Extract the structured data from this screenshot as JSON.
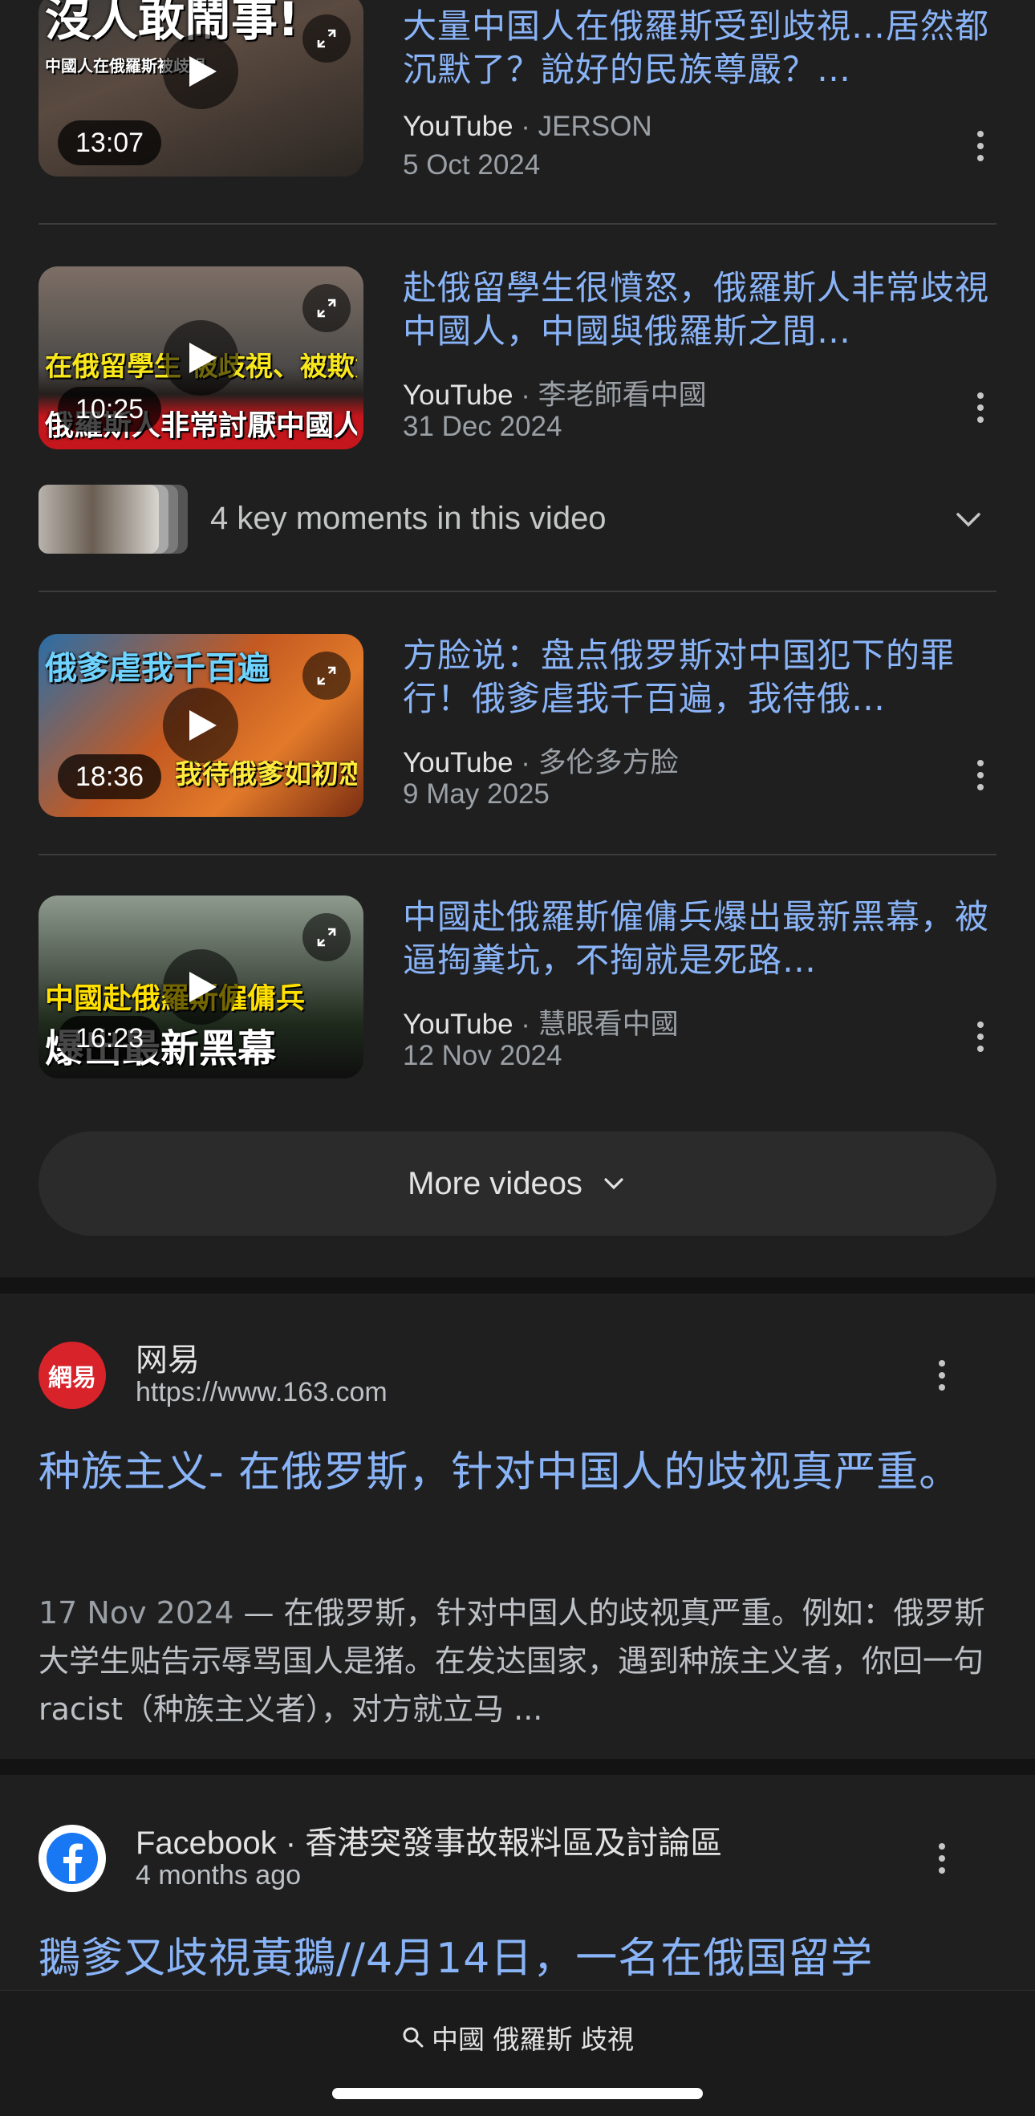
{
  "videos": [
    {
      "title": "大量中国人在俄羅斯受到歧視…居然都沉默了？說好的民族尊嚴？…",
      "platform": "YouTube",
      "channel": "JERSON",
      "date": "5 Oct 2024",
      "duration": "13:07",
      "thumb_text_1": "沒人敢鬧事!",
      "thumb_text_2": "中國人在俄羅斯被歧視"
    },
    {
      "title": "赴俄留學生很憤怒，俄羅斯人非常歧視中國人，中國與俄羅斯之間…",
      "platform": "YouTube",
      "channel": "李老師看中國",
      "date": "31 Dec 2024",
      "duration": "10:25",
      "thumb_text_1": "在俄留學生 被歧視、被欺負",
      "thumb_text_2": "俄羅斯人非常討厭中國人"
    },
    {
      "title": "方脸说：盘点俄罗斯对中国犯下的罪行！俄爹虐我千百遍，我待俄…",
      "platform": "YouTube",
      "channel": "多伦多方脸",
      "date": "9 May 2025",
      "duration": "18:36",
      "thumb_text_1": "俄爹虐我千百遍",
      "thumb_text_2": "我待俄爹如初恋!"
    },
    {
      "title": "中國赴俄羅斯僱傭兵爆出最新黑幕，被逼掏糞坑，不掏就是死路…",
      "platform": "YouTube",
      "channel": "慧眼看中國",
      "date": "12 Nov 2024",
      "duration": "16:23",
      "thumb_text_1": "中國赴俄羅斯僱傭兵",
      "thumb_text_2": "爆出最新黑幕"
    }
  ],
  "key_moments": {
    "label": "4 key moments in this video"
  },
  "more_videos": {
    "label": "More videos"
  },
  "results": [
    {
      "site_name": "网易",
      "url": "https://www.163.com",
      "favicon_text": "網易",
      "title": "种族主义- 在俄罗斯，针对中国人的歧视真严重。",
      "date": "17 Nov 2024",
      "snippet": " — 在俄罗斯，针对中国人的歧视真严重。例如：俄罗斯大学生贴告示辱骂国人是猪。在发达国家，遇到种族主义者，你回一句racist（种族主义者），对方就立马 ..."
    },
    {
      "site_name": "Facebook · 香港突發事故報料區及討論區",
      "meta": "4 months ago",
      "title": "鵝爹又歧視黃鵝//4月14日，一名在俄国留学"
    }
  ],
  "search_bar": {
    "query": "中國 俄羅斯 歧視"
  },
  "colors": {
    "background": "#1f1f1f",
    "link": "#8ab4f8",
    "netease_red": "#d8232a",
    "facebook_blue": "#1877f2"
  }
}
